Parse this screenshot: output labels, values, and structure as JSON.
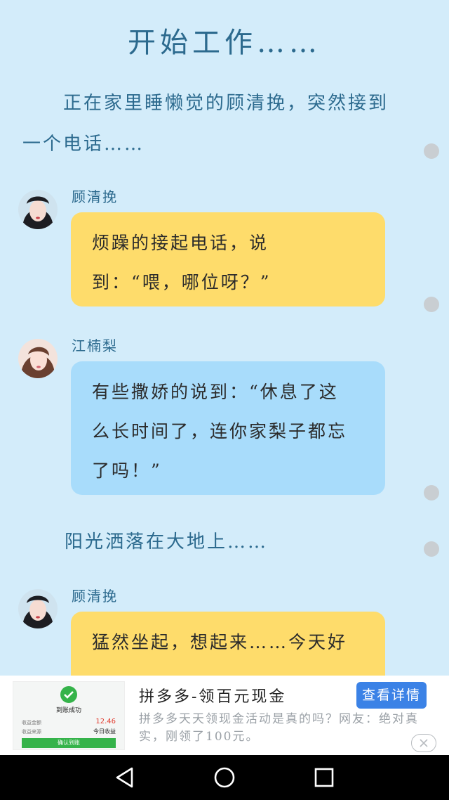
{
  "title": "开始工作……",
  "narration_1": "正在家里睡懒觉的顾清挽，突然接到一个电话……",
  "narration_1_line1": "正在家里睡懒觉的顾清挽，突然接到",
  "narration_1_line2": "一个电话……",
  "messages": [
    {
      "speaker": "顾清挽",
      "lines": [
        "烦躁的接起电话，说",
        "到：“喂，哪位呀？”"
      ],
      "color": "#fedc6b"
    },
    {
      "speaker": "江楠梨",
      "lines": [
        "有些撒娇的说到：“休息了这",
        "么长时间了，连你家梨子都忘",
        "了吗！”"
      ],
      "color": "#a8dcfb"
    },
    {
      "speaker": "顾清挽",
      "lines": [
        "猛然坐起，想起来……今天好"
      ],
      "color": "#fedc6b"
    }
  ],
  "narration_2": "阳光洒落在大地上……",
  "ad": {
    "title": "拼多多-领百元现金",
    "description": "拼多多天天领现金活动是真的吗？网友：绝对真实，刚领了100元。",
    "button": "查看详情",
    "thumb": {
      "status": "到账成功",
      "row1_label": "收益金额",
      "row1_value": "12.46",
      "row2_label": "收益来源",
      "row2_value": "今日收益",
      "confirm": "确认到账"
    }
  },
  "colors": {
    "background": "#d3ecfa",
    "accent_text": "#2c6a8e",
    "bubble_yellow": "#fedc6b",
    "bubble_blue": "#a8dcfb",
    "ad_button": "#3b82e6"
  }
}
